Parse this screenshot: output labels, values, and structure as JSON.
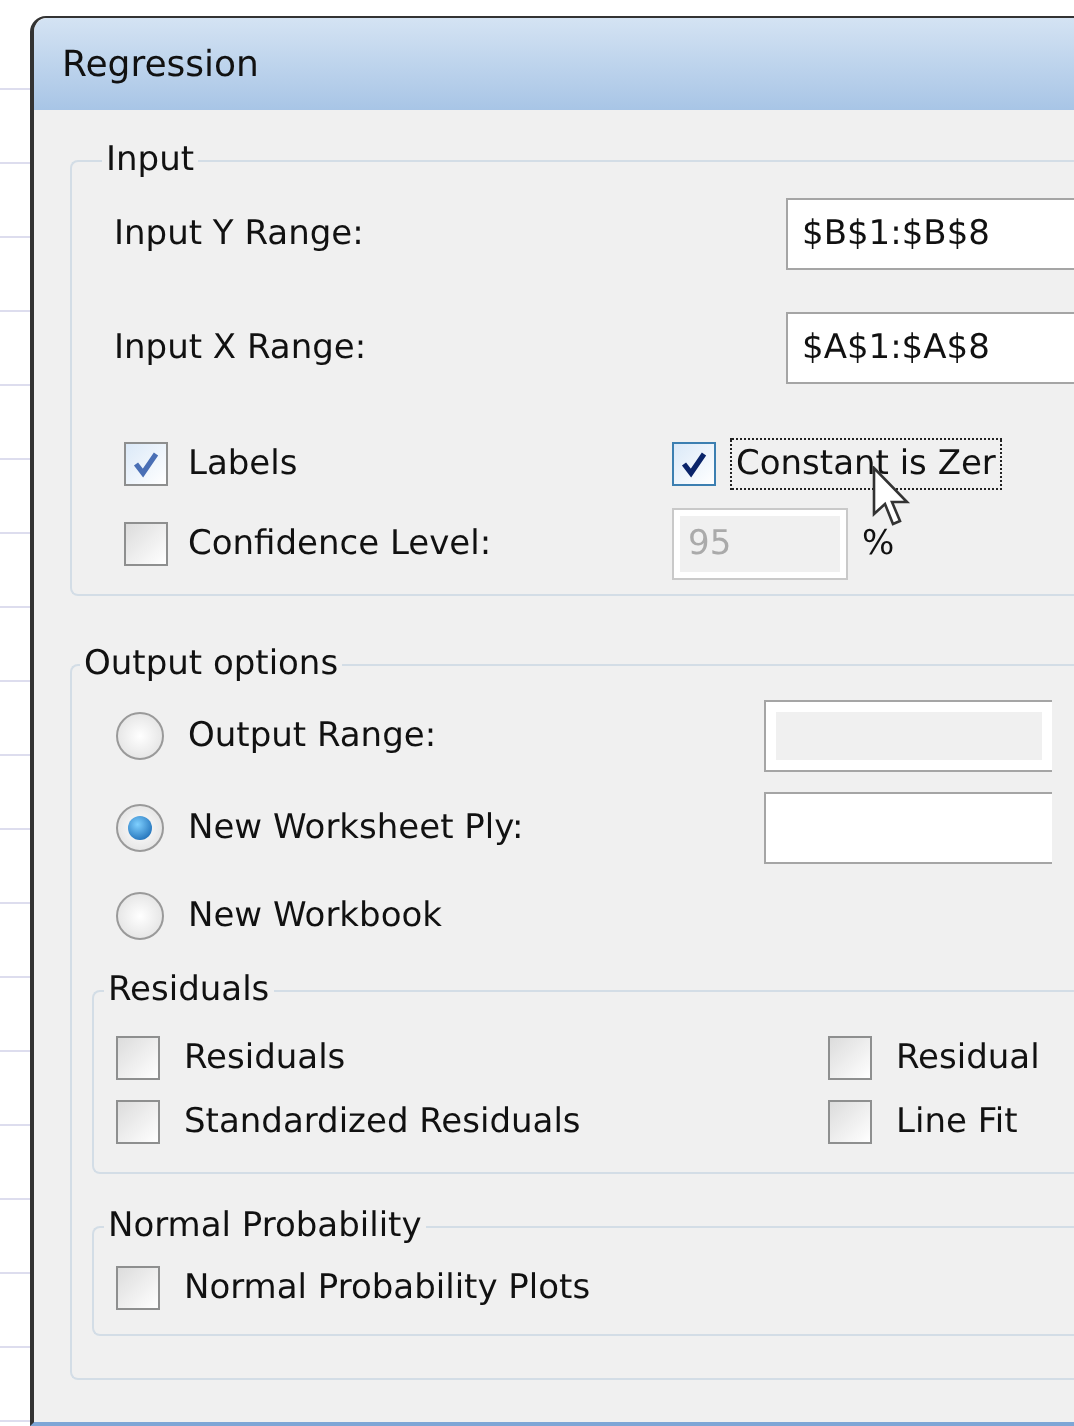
{
  "window": {
    "title": "Regression"
  },
  "input": {
    "legend": "Input",
    "ranges": [
      {
        "label": "Input Y Range:",
        "value": "$B$1:$B$8"
      },
      {
        "label": "Input X Range:",
        "value": "$A$1:$A$8"
      }
    ],
    "options": [
      {
        "label": "Labels",
        "checked": true,
        "focused": false
      },
      {
        "label": "Constant is Zer",
        "checked": true,
        "focused": true
      }
    ],
    "confidence": {
      "label": "Confidence Level:",
      "checked": false,
      "value": "95",
      "value_disabled": true,
      "unit": "%"
    }
  },
  "output": {
    "legend": "Output options",
    "choices": [
      {
        "label": "Output Range:",
        "selected": false,
        "field": {
          "disabled": true
        }
      },
      {
        "label": "New Worksheet Ply:",
        "selected": true,
        "field": {
          "disabled": false
        }
      },
      {
        "label": "New Workbook",
        "selected": false
      }
    ],
    "groups": [
      {
        "legend": "Residuals",
        "items": [
          {
            "label": "Residuals",
            "checked": false
          },
          {
            "label": "Residual",
            "checked": false
          },
          {
            "label": "Standardized Residuals",
            "checked": false
          },
          {
            "label": "Line Fit",
            "checked": false
          }
        ]
      },
      {
        "legend": "Normal Probability",
        "items": [
          {
            "label": "Normal Probability Plots",
            "checked": false
          }
        ]
      }
    ]
  }
}
